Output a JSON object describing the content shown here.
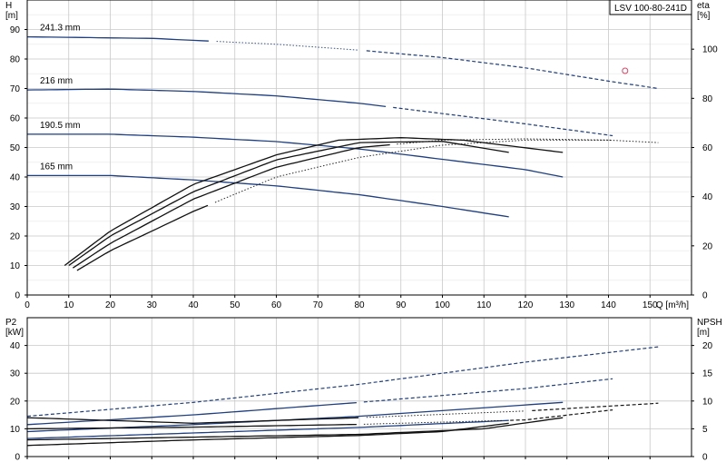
{
  "chart_data": [
    {
      "type": "line",
      "id": "head",
      "title": "LSV 100-80-241D",
      "ylabel_lines": [
        "H",
        "[m]"
      ],
      "y2label_lines": [
        "eta",
        "[%]"
      ],
      "xlabel": "Q [m³/h]",
      "xlim": [
        0,
        160
      ],
      "ylim": [
        0,
        100
      ],
      "y2lim": [
        0,
        120
      ],
      "xticks": [
        "0",
        "10",
        "20",
        "30",
        "40",
        "50",
        "60",
        "70",
        "80",
        "90",
        "100",
        "110",
        "120",
        "130",
        "140",
        "150"
      ],
      "yticks": [
        "0",
        "10",
        "20",
        "30",
        "40",
        "50",
        "60",
        "70",
        "80",
        "90"
      ],
      "y2ticks": [
        "0",
        "20",
        "40",
        "60",
        "80",
        "100"
      ],
      "grid": true,
      "series": [
        {
          "name": "241.3 mm",
          "color": "#1f3f7f",
          "x": [
            0,
            30,
            60,
            80,
            100,
            120,
            140,
            152
          ],
          "y": [
            87.5,
            87,
            85,
            83,
            80.5,
            77,
            72.5,
            70
          ],
          "solid_to": 45,
          "dash_from": 80
        },
        {
          "name": "216 mm",
          "color": "#1f3f7f",
          "x": [
            0,
            20,
            40,
            60,
            80,
            100,
            120,
            141
          ],
          "y": [
            69.5,
            69.8,
            69,
            67.5,
            65,
            61.5,
            58,
            54
          ],
          "solid_to": 88,
          "dash_from": 88
        },
        {
          "name": "190.5 mm",
          "color": "#1f3f7f",
          "x": [
            0,
            20,
            40,
            60,
            80,
            100,
            120,
            129
          ],
          "y": [
            54.5,
            54.5,
            53.5,
            52,
            49.5,
            46,
            42.5,
            40
          ],
          "solid_to": 129,
          "dash_from": 129
        },
        {
          "name": "165 mm",
          "color": "#1f3f7f",
          "x": [
            0,
            20,
            40,
            60,
            80,
            100,
            116
          ],
          "y": [
            40.5,
            40.5,
            39,
            37,
            34,
            30,
            26.5
          ],
          "solid_to": 116,
          "dash_from": 116
        },
        {
          "axis": "y2",
          "color": "#111111",
          "x": [
            9,
            20,
            40,
            60,
            75,
            90,
            105,
            129
          ],
          "y": [
            12,
            26,
            45,
            57,
            63,
            64,
            63,
            58
          ],
          "solid_to": 129,
          "dash_from": 129
        },
        {
          "axis": "y2",
          "color": "#111111",
          "x": [
            10,
            20,
            40,
            60,
            80,
            100,
            116
          ],
          "y": [
            12,
            24,
            42,
            55,
            62,
            62.5,
            58
          ],
          "solid_to": 116,
          "dash_from": 116
        },
        {
          "axis": "y2",
          "color": "#111111",
          "x": [
            11,
            20,
            40,
            60,
            80,
            100,
            120,
            141
          ],
          "y": [
            11,
            21,
            39,
            52,
            60,
            63,
            63.5,
            63
          ],
          "solid_to": 88,
          "dash_from": 141
        },
        {
          "axis": "y2",
          "color": "#111111",
          "x": [
            12,
            20,
            40,
            60,
            80,
            100,
            120,
            140,
            152
          ],
          "y": [
            10,
            18,
            34,
            48,
            56,
            61,
            63,
            63,
            62
          ],
          "solid_to": 45,
          "dash_from": 152
        }
      ],
      "markers": [
        {
          "x": 144,
          "y": 76,
          "color": "#e04060"
        }
      ]
    },
    {
      "type": "line",
      "id": "power",
      "ylabel_lines": [
        "P2",
        "[kW]"
      ],
      "y2label_lines": [
        "NPSH",
        "[m]"
      ],
      "xlim": [
        0,
        160
      ],
      "ylim": [
        0,
        50
      ],
      "y2lim": [
        0,
        25
      ],
      "yticks": [
        "0",
        "10",
        "20",
        "30",
        "40"
      ],
      "y2ticks": [
        "0",
        "5",
        "10",
        "15",
        "20"
      ],
      "grid": true,
      "series": [
        {
          "color": "#1f3f7f",
          "x": [
            0,
            40,
            80,
            120,
            152
          ],
          "y": [
            14.5,
            19.5,
            26,
            34,
            39.5
          ],
          "solid_to": 0,
          "dash_from": 0
        },
        {
          "color": "#1f3f7f",
          "x": [
            0,
            40,
            80,
            120,
            141
          ],
          "y": [
            11.5,
            15,
            19.5,
            24.5,
            28
          ],
          "solid_to": 80,
          "dash_from": 80
        },
        {
          "color": "#1f3f7f",
          "x": [
            0,
            40,
            80,
            129
          ],
          "y": [
            9,
            11.5,
            14.5,
            19.5
          ],
          "solid_to": 129,
          "dash_from": 129
        },
        {
          "color": "#1f3f7f",
          "x": [
            0,
            40,
            80,
            116
          ],
          "y": [
            6.5,
            8.5,
            10.5,
            13
          ],
          "solid_to": 116,
          "dash_from": 116
        },
        {
          "axis": "y2",
          "color": "#111111",
          "x": [
            0,
            40,
            80,
            120,
            152
          ],
          "y": [
            7,
            6,
            7,
            8.2,
            9.6
          ],
          "solid_to": 80,
          "dash_from": 120
        },
        {
          "axis": "y2",
          "color": "#111111",
          "x": [
            0,
            40,
            80,
            120,
            141
          ],
          "y": [
            5,
            5.3,
            5.8,
            6.6,
            8.4
          ],
          "solid_to": 80,
          "dash_from": 115
        },
        {
          "axis": "y2",
          "color": "#111111",
          "x": [
            0,
            40,
            80,
            110,
            129
          ],
          "y": [
            3,
            3.5,
            4,
            5,
            7
          ],
          "solid_to": 129,
          "dash_from": 129
        },
        {
          "axis": "y2",
          "color": "#111111",
          "x": [
            0,
            40,
            80,
            100,
            116
          ],
          "y": [
            2,
            3,
            3.8,
            4.5,
            6
          ],
          "solid_to": 116,
          "dash_from": 116
        }
      ]
    }
  ]
}
